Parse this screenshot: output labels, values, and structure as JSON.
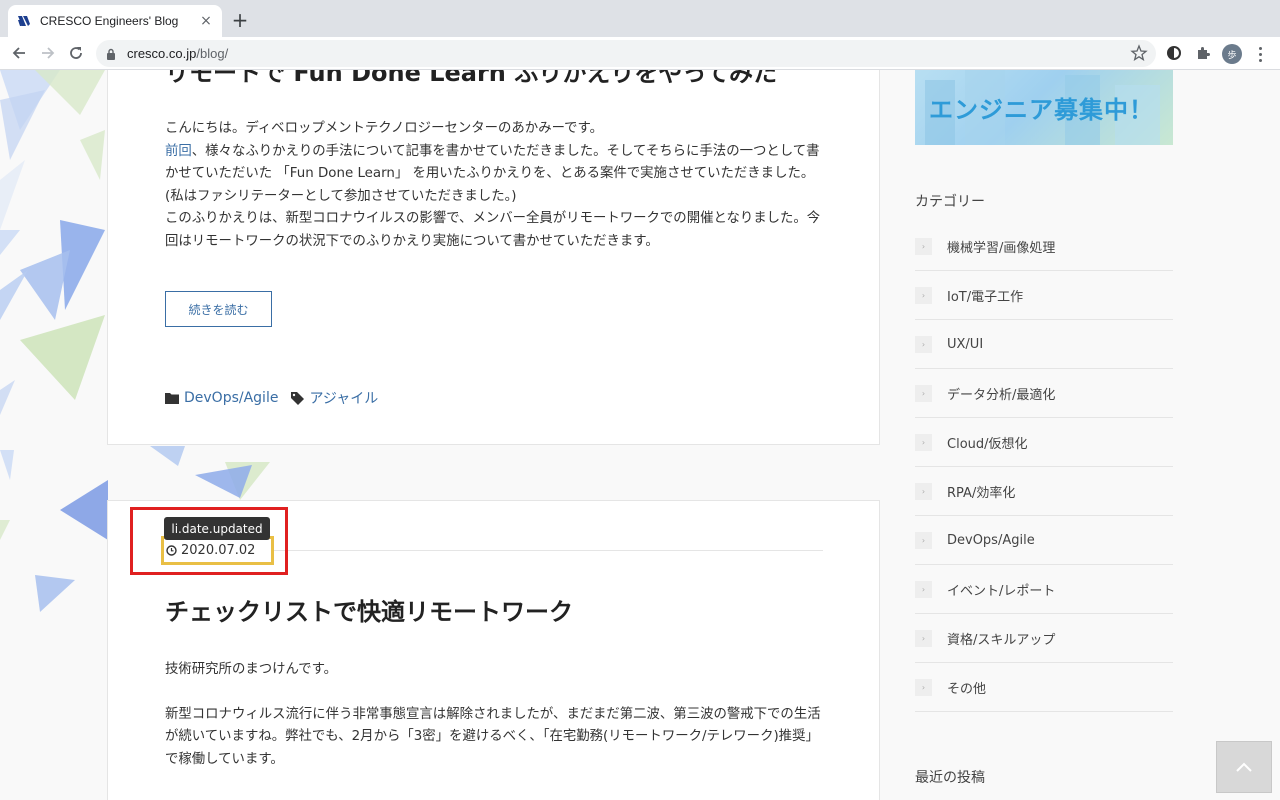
{
  "browser": {
    "tab_title": "CRESCO Engineers' Blog",
    "tab_close": "×",
    "new_tab": "+",
    "url_host": "cresco.co.jp",
    "url_path": "/blog/",
    "profile_initial": "歩"
  },
  "post1": {
    "title": "リモートで Fun Done Learn ふりかえりをやってみた",
    "intro": "こんにちは。ディベロップメントテクノロジーセンターのあかみーです。",
    "link_prev": "前回",
    "para1_rest": "、様々なふりかえりの手法について記事を書かせていただきました。そしてそちらに手法の一つとして書かせていただいた 「Fun Done Learn」 を用いたふりかえりを、とある案件で実施させていただきました。(私はファシリテーターとして参加させていただきました。)",
    "para2": "このふりかえりは、新型コロナウイルスの影響で、メンバー全員がリモートワークでの開催となりました。今回はリモートワークの状況下でのふりかえり実施について書かせていただきます。",
    "read_more": "続きを読む",
    "category": "DevOps/Agile",
    "tag": "アジャイル"
  },
  "post2": {
    "tooltip": "li.date.updated",
    "date": "2020.07.02",
    "title": "チェックリストで快適リモートワーク",
    "intro": "技術研究所のまつけんです。",
    "para1": "新型コロナウィルス流行に伴う非常事態宣言は解除されましたが、まだまだ第二波、第三波の警戒下での生活が続いていますね。弊社でも、2月から「3密」を避けるべく、「在宅勤務(リモートワーク/テレワーク)推奨」で稼働しています。"
  },
  "sidebar": {
    "banner_text": "エンジニア募集中！",
    "categories_heading": "カテゴリー",
    "categories": [
      "機械学習/画像処理",
      "IoT/電子工作",
      "UX/UI",
      "データ分析/最適化",
      "Cloud/仮想化",
      "RPA/効率化",
      "DevOps/Agile",
      "イベント/レポート",
      "資格/スキルアップ",
      "その他"
    ],
    "recent_heading": "最近の投稿"
  }
}
